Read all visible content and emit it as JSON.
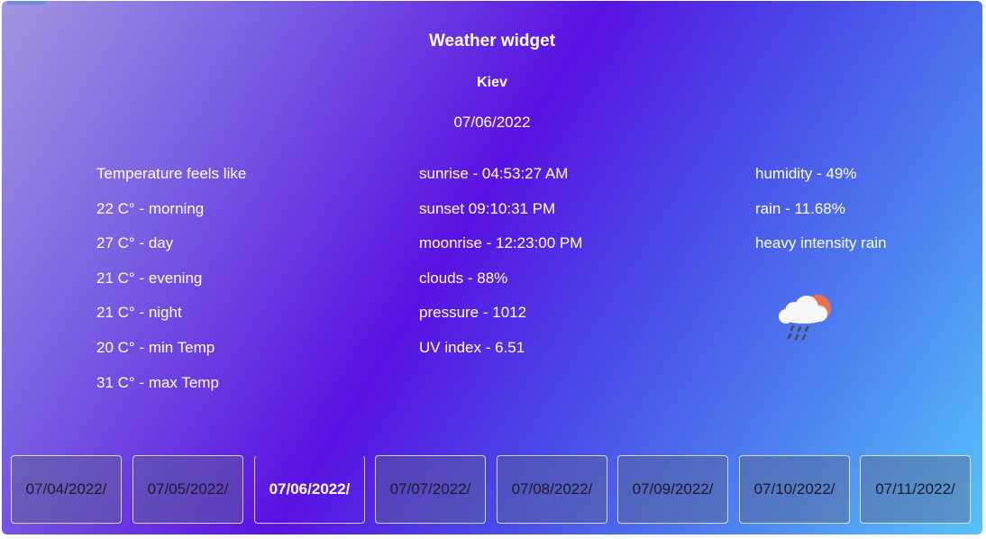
{
  "widget": {
    "title": "Weather widget",
    "city": "Kiev",
    "date": "07/06/2022"
  },
  "temperature": {
    "header": "Temperature feels like",
    "morning": "22 C° - morning",
    "day": "27 C° - day",
    "evening": "21 C° - evening",
    "night": "21 C° - night",
    "min": "20 C° - min Temp",
    "max": "31 C° - max Temp"
  },
  "details": {
    "sunrise": "sunrise - 04:53:27 AM",
    "sunset": "sunset 09:10:31 PM",
    "moonrise": "moonrise - 12:23:00 PM",
    "clouds": "clouds - 88%",
    "pressure": "pressure - 1012",
    "uv_index": "UV index - 6.51"
  },
  "conditions": {
    "humidity": "humidity - 49%",
    "rain": "rain - 11.68%",
    "description": "heavy intensity rain",
    "icon": "rain-cloud-sun-icon"
  },
  "day_tabs": [
    {
      "label": "07/04/2022/",
      "active": false
    },
    {
      "label": "07/05/2022/",
      "active": false
    },
    {
      "label": "07/06/2022/",
      "active": true
    },
    {
      "label": "07/07/2022/",
      "active": false
    },
    {
      "label": "07/08/2022/",
      "active": false
    },
    {
      "label": "07/09/2022/",
      "active": false
    },
    {
      "label": "07/10/2022/",
      "active": false
    },
    {
      "label": "07/11/2022/",
      "active": false
    }
  ],
  "colors": {
    "gradient_start": "#a394e0",
    "gradient_mid": "#5a12e2",
    "gradient_end": "#57c3fb",
    "active_tab_text": "#ffffff",
    "tab_text": "#1b1b2e"
  }
}
